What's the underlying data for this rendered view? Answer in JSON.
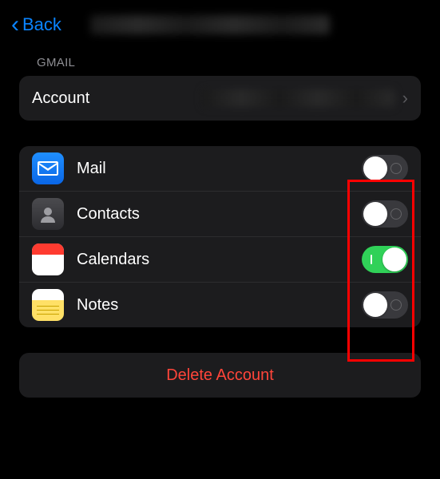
{
  "header": {
    "back_label": "Back",
    "title_redacted": true
  },
  "section_label": "GMAIL",
  "account": {
    "label": "Account",
    "value_redacted": true
  },
  "services": [
    {
      "id": "mail",
      "label": "Mail",
      "enabled": false
    },
    {
      "id": "contacts",
      "label": "Contacts",
      "enabled": false
    },
    {
      "id": "calendars",
      "label": "Calendars",
      "enabled": true
    },
    {
      "id": "notes",
      "label": "Notes",
      "enabled": false
    }
  ],
  "delete_label": "Delete Account",
  "colors": {
    "accent": "#0a84ff",
    "destructive": "#ff453a",
    "toggle_on": "#30d158",
    "highlight": "#ff0000"
  }
}
